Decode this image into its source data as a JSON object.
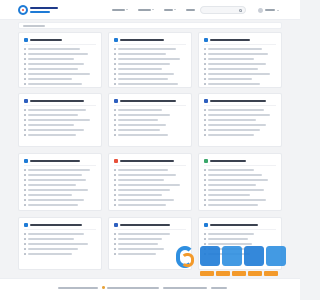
{
  "logo_text": "",
  "nav": [
    {
      "label": ""
    },
    {
      "label": ""
    },
    {
      "label": ""
    },
    {
      "label": ""
    },
    {
      "label": ""
    }
  ],
  "search": {
    "placeholder": ""
  },
  "user": {
    "label": ""
  },
  "filter_bar": {
    "label": ""
  },
  "cards": [
    {
      "title": "",
      "items": [
        "",
        "",
        "",
        "",
        "",
        "",
        "",
        ""
      ]
    },
    {
      "title": "",
      "items": [
        "",
        "",
        "",
        "",
        "",
        "",
        "",
        ""
      ]
    },
    {
      "title": "",
      "items": [
        "",
        "",
        "",
        "",
        "",
        "",
        "",
        ""
      ]
    },
    {
      "title": "",
      "items": [
        "",
        "",
        "",
        "",
        "",
        ""
      ]
    },
    {
      "title": "",
      "items": [
        "",
        "",
        "",
        "",
        "",
        ""
      ]
    },
    {
      "title": "",
      "items": [
        "",
        "",
        "",
        "",
        "",
        ""
      ]
    },
    {
      "title": "",
      "items": [
        "",
        "",
        "",
        "",
        "",
        "",
        "",
        ""
      ]
    },
    {
      "title": "",
      "items": [
        "",
        "",
        "",
        "",
        "",
        "",
        "",
        ""
      ]
    },
    {
      "title": "",
      "items": [
        "",
        "",
        "",
        "",
        "",
        "",
        "",
        ""
      ]
    },
    {
      "title": "",
      "items": [
        "",
        "",
        "",
        "",
        ""
      ]
    },
    {
      "title": "",
      "items": [
        "",
        "",
        "",
        "",
        ""
      ]
    },
    {
      "title": "",
      "items": [
        "",
        "",
        "",
        "",
        ""
      ]
    }
  ],
  "footer": {
    "copyright": "",
    "icp": "",
    "police": "",
    "links": ""
  },
  "watermark": {
    "brand": "",
    "slogan": ""
  },
  "colors": {
    "accent": "#1e7bd6",
    "page_bg": "#f2f3f5",
    "card_bg": "#ffffff",
    "watermark_orange": "#f39a2b"
  }
}
